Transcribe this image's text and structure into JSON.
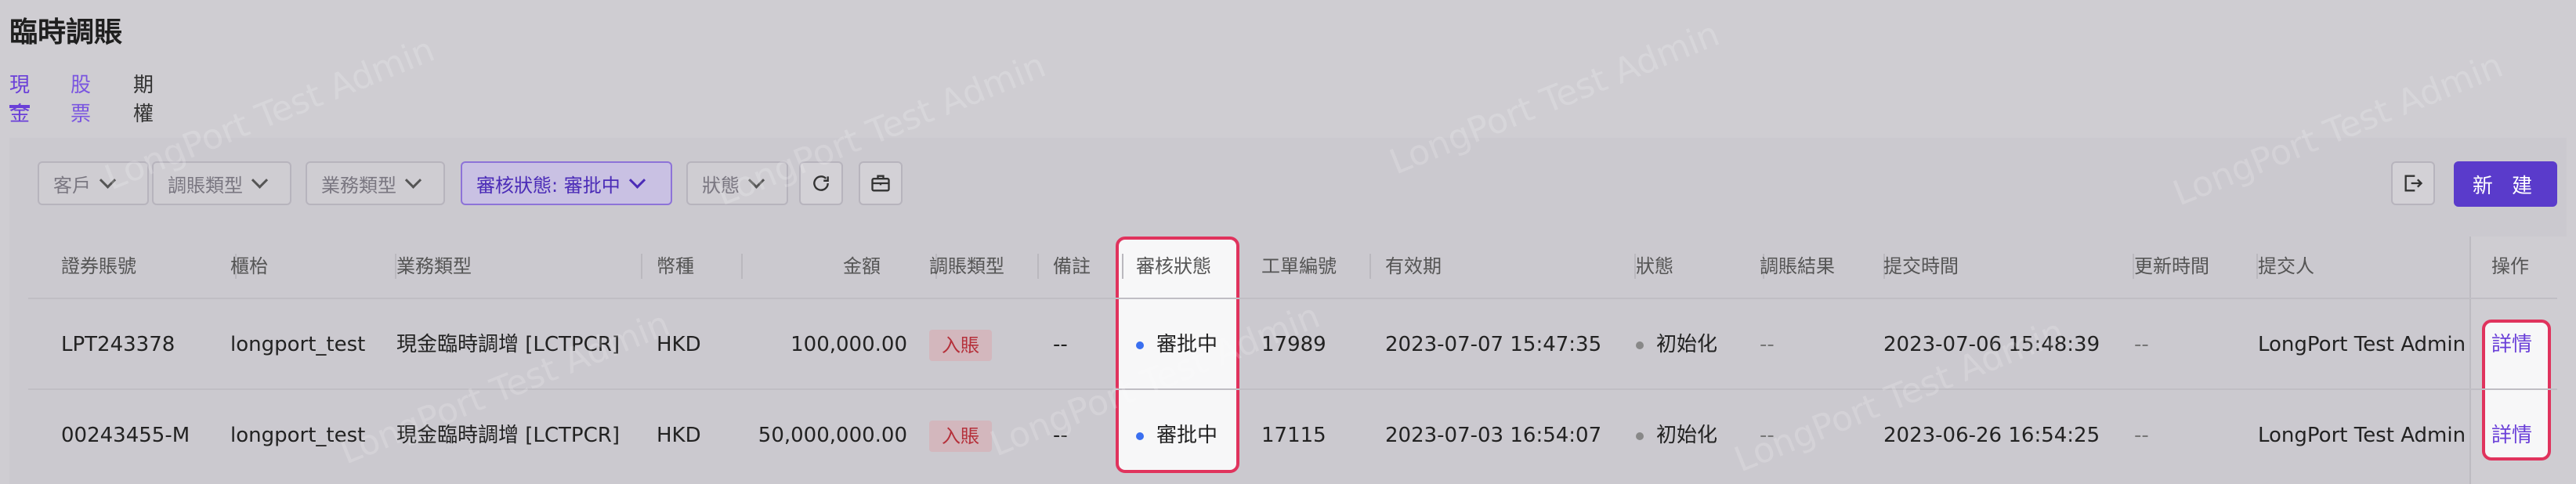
{
  "page": {
    "title": "臨時調賬",
    "watermark_text": "LongPort Test Admin"
  },
  "tabs": [
    {
      "label": "現金",
      "active": true
    },
    {
      "label": "股票",
      "active": false
    },
    {
      "label": "期權",
      "active": false
    }
  ],
  "filters": {
    "customer": "客戶",
    "adjust_type": "調賬類型",
    "business_type": "業務類型",
    "review_status": "審核狀態: 審批中",
    "status": "狀態"
  },
  "toolbar": {
    "new_label": "新 建"
  },
  "table": {
    "columns": [
      "證券賬號",
      "櫃枱",
      "業務類型",
      "幣種",
      "金額",
      "調賬類型",
      "備註",
      "審核狀態",
      "工單編號",
      "有效期",
      "狀態",
      "調賬結果",
      "提交時間",
      "更新時間",
      "提交人",
      "操作"
    ],
    "rows": [
      {
        "account": "LPT243378",
        "counter": "longport_test",
        "business_type": "現金臨時調增 [LCTPCR]",
        "currency": "HKD",
        "amount": "100,000.00",
        "adjust_type": "入賬",
        "remark": "--",
        "review_status": "審批中",
        "ticket_no": "17989",
        "valid_until": "2023-07-07 15:47:35",
        "status": "初始化",
        "adjust_result": "--",
        "submit_time": "2023-07-06 15:48:39",
        "update_time": "--",
        "submitter": "LongPort Test Admin",
        "action": "詳情"
      },
      {
        "account": "00243455-M",
        "counter": "longport_test",
        "business_type": "現金臨時調增 [LCTPCR]",
        "currency": "HKD",
        "amount": "50,000,000.00",
        "adjust_type": "入賬",
        "remark": "--",
        "review_status": "審批中",
        "ticket_no": "17115",
        "valid_until": "2023-07-03 16:54:07",
        "status": "初始化",
        "adjust_result": "--",
        "submit_time": "2023-06-26 16:54:25",
        "update_time": "--",
        "submitter": "LongPort Test Admin",
        "action": "詳情"
      }
    ]
  },
  "colors": {
    "accent": "#6a3fd8",
    "highlight_border": "#e0335d",
    "tag_in_text": "#b5303a",
    "status_blue": "#3a6ff0"
  },
  "icons": [
    "chevron-down-icon",
    "refresh-icon",
    "toolbox-icon",
    "export-icon",
    "dot-icon"
  ]
}
